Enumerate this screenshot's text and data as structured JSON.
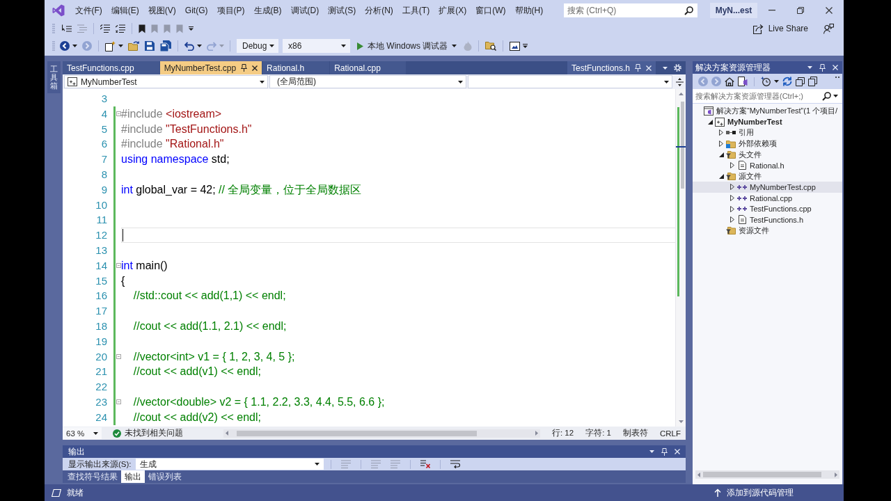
{
  "menu_bar": {
    "items": [
      "文件(F)",
      "编辑(E)",
      "视图(V)",
      "Git(G)",
      "项目(P)",
      "生成(B)",
      "调试(D)",
      "测试(S)",
      "分析(N)",
      "工具(T)",
      "扩展(X)",
      "窗口(W)",
      "帮助(H)"
    ],
    "search": {
      "placeholder": "搜索 (Ctrl+Q)"
    },
    "solution_name": "MyN...est"
  },
  "toolbar_1": {
    "buttons": [
      {
        "disabled": false
      },
      {
        "disabled": true
      },
      {
        "disabled": false
      },
      {
        "disabled": false
      },
      {
        "disabled": false
      },
      {
        "disabled": true
      },
      {
        "disabled": true
      },
      {
        "disabled": true
      }
    ],
    "live_share": "Live Share"
  },
  "toolbar_2": {
    "buttons": [
      {
        "disabled": false
      },
      {
        "disabled": true
      },
      {
        "disabled": false
      },
      {
        "disabled": false
      },
      {
        "disabled": false
      },
      {
        "disabled": false
      },
      {
        "disabled": false
      },
      {
        "disabled": true
      },
      {
        "disabled": true
      },
      {
        "disabled": false
      },
      {
        "disabled": false
      }
    ],
    "configuration": "Debug",
    "platform": "x86",
    "start": "本地 Windows 调试器"
  },
  "toolbox_tab": "工具箱",
  "document_tabs": [
    {
      "label": "TestFunctions.cpp",
      "selected": false
    },
    {
      "label": "MyNumberTest.cpp",
      "selected": true
    },
    {
      "label": "Rational.h",
      "selected": false
    },
    {
      "label": "Rational.cpp",
      "selected": false
    }
  ],
  "preview_tab": {
    "label": "TestFunctions.h"
  },
  "navigation_bar": {
    "project": "MyNumberTest",
    "scope": "(全局范围)"
  },
  "editor": {
    "lines": [
      {
        "number": "3",
        "changed": false,
        "fold": false,
        "current": false
      },
      {
        "number": "4",
        "changed": true,
        "fold": true,
        "current": false,
        "tokens": [
          {
            "kind": "preprocessor",
            "text": "#include "
          },
          {
            "kind": "string",
            "text": "<iostream>"
          }
        ]
      },
      {
        "number": "5",
        "changed": true,
        "fold": false,
        "current": false,
        "tokens": [
          {
            "kind": "preprocessor",
            "text": "#include "
          },
          {
            "kind": "string",
            "text": "\"TestFunctions.h\""
          }
        ]
      },
      {
        "number": "6",
        "changed": true,
        "fold": false,
        "current": false,
        "tokens": [
          {
            "kind": "preprocessor",
            "text": "#include "
          },
          {
            "kind": "string",
            "text": "\"Rational.h\""
          }
        ]
      },
      {
        "number": "7",
        "changed": true,
        "fold": false,
        "current": false,
        "tokens": [
          {
            "kind": "keyword",
            "text": "using "
          },
          {
            "kind": "keyword",
            "text": "namespace"
          },
          {
            "kind": "plain",
            "text": " std;"
          }
        ]
      },
      {
        "number": "8",
        "changed": true,
        "fold": false,
        "current": false
      },
      {
        "number": "9",
        "changed": true,
        "fold": false,
        "current": false,
        "tokens": [
          {
            "kind": "keyword",
            "text": "int"
          },
          {
            "kind": "plain",
            "text": " global_var = 42; "
          },
          {
            "kind": "comment",
            "text": "// 全局变量，位于全局数据区"
          }
        ]
      },
      {
        "number": "10",
        "changed": true,
        "fold": false,
        "current": false
      },
      {
        "number": "11",
        "changed": true,
        "fold": false,
        "current": false
      },
      {
        "number": "12",
        "changed": true,
        "fold": false,
        "current": true
      },
      {
        "number": "13",
        "changed": true,
        "fold": false,
        "current": false
      },
      {
        "number": "14",
        "changed": true,
        "fold": true,
        "current": false,
        "tokens": [
          {
            "kind": "keyword",
            "text": "int"
          },
          {
            "kind": "plain",
            "text": " main()"
          }
        ]
      },
      {
        "number": "15",
        "changed": true,
        "fold": false,
        "current": false,
        "tokens": [
          {
            "kind": "plain",
            "text": "{"
          }
        ]
      },
      {
        "number": "16",
        "changed": true,
        "fold": false,
        "current": false,
        "tokens": [
          {
            "kind": "comment",
            "text": "    //std::cout << add(1,1) << endl;"
          }
        ]
      },
      {
        "number": "17",
        "changed": true,
        "fold": false,
        "current": false
      },
      {
        "number": "18",
        "changed": true,
        "fold": false,
        "current": false,
        "tokens": [
          {
            "kind": "comment",
            "text": "    //cout << add(1.1, 2.1) << endl;"
          }
        ]
      },
      {
        "number": "19",
        "changed": true,
        "fold": false,
        "current": false
      },
      {
        "number": "20",
        "changed": true,
        "fold": true,
        "current": false,
        "tokens": [
          {
            "kind": "comment",
            "text": "    //vector<int> v1 = { 1, 2, 3, 4, 5 };"
          }
        ]
      },
      {
        "number": "21",
        "changed": true,
        "fold": false,
        "current": false,
        "tokens": [
          {
            "kind": "comment",
            "text": "    //cout << add(v1) << endl;"
          }
        ]
      },
      {
        "number": "22",
        "changed": true,
        "fold": false,
        "current": false
      },
      {
        "number": "23",
        "changed": true,
        "fold": true,
        "current": false,
        "tokens": [
          {
            "kind": "comment",
            "text": "    //vector<double> v2 = { 1.1, 2.2, 3.3, 4.4, 5.5, 6.6 };"
          }
        ]
      },
      {
        "number": "24",
        "changed": true,
        "fold": false,
        "current": false,
        "tokens": [
          {
            "kind": "comment",
            "text": "    //cout << add(v2) << endl;"
          }
        ]
      }
    ]
  },
  "editor_status": {
    "zoom": "63 %",
    "issues": "未找到相关问题",
    "line": "行: 12",
    "column": "字符: 1",
    "indent": "制表符",
    "line_ending": "CRLF"
  },
  "output_panel": {
    "title": "输出",
    "source_label": "显示输出来源(S):",
    "source": "生成",
    "buttons": [
      {
        "disabled": true
      },
      {
        "disabled": true
      },
      {
        "disabled": true
      },
      {
        "disabled": false
      },
      {
        "disabled": false
      }
    ],
    "tabs": [
      {
        "label": "查找符号结果",
        "selected": false
      },
      {
        "label": "输出",
        "selected": true
      },
      {
        "label": "错误列表",
        "selected": false
      }
    ]
  },
  "solution_explorer": {
    "title": "解决方案资源管理器",
    "buttons": [
      {
        "disabled": true
      },
      {
        "disabled": true
      },
      {
        "disabled": false
      },
      {
        "disabled": false
      },
      {
        "disabled": false
      },
      {
        "disabled": false
      },
      {
        "disabled": false
      },
      {
        "disabled": false
      }
    ],
    "search": {
      "placeholder": "搜索解决方案资源管理器(Ctrl+;)"
    },
    "tree": [
      {
        "label": "解决方案“MyNumberTest”(1 个项目/",
        "kind": "solution",
        "selected": false,
        "children": [
          {
            "label": "MyNumberTest",
            "kind": "project",
            "expanded": true,
            "selected": false,
            "children": [
              {
                "label": "引用",
                "kind": "references",
                "expanded": false,
                "selected": false
              },
              {
                "label": "外部依赖项",
                "kind": "dependencies",
                "expanded": false,
                "selected": false
              },
              {
                "label": "头文件",
                "kind": "folder",
                "expanded": true,
                "selected": false,
                "children": [
                  {
                    "label": "Rational.h",
                    "kind": "header",
                    "expanded": false,
                    "selected": false
                  }
                ]
              },
              {
                "label": "源文件",
                "kind": "folder",
                "expanded": true,
                "selected": false,
                "children": [
                  {
                    "label": "MyNumberTest.cpp",
                    "kind": "source",
                    "expanded": false,
                    "selected": true
                  },
                  {
                    "label": "Rational.cpp",
                    "kind": "source",
                    "expanded": false,
                    "selected": false
                  },
                  {
                    "label": "TestFunctions.cpp",
                    "kind": "source",
                    "expanded": false,
                    "selected": false
                  },
                  {
                    "label": "TestFunctions.h",
                    "kind": "header",
                    "expanded": false,
                    "selected": false
                  }
                ]
              },
              {
                "label": "资源文件",
                "kind": "folder",
                "selected": false
              }
            ]
          }
        ]
      }
    ]
  },
  "status_bar": {
    "text": "就绪",
    "source_control": "添加到源代码管理"
  }
}
